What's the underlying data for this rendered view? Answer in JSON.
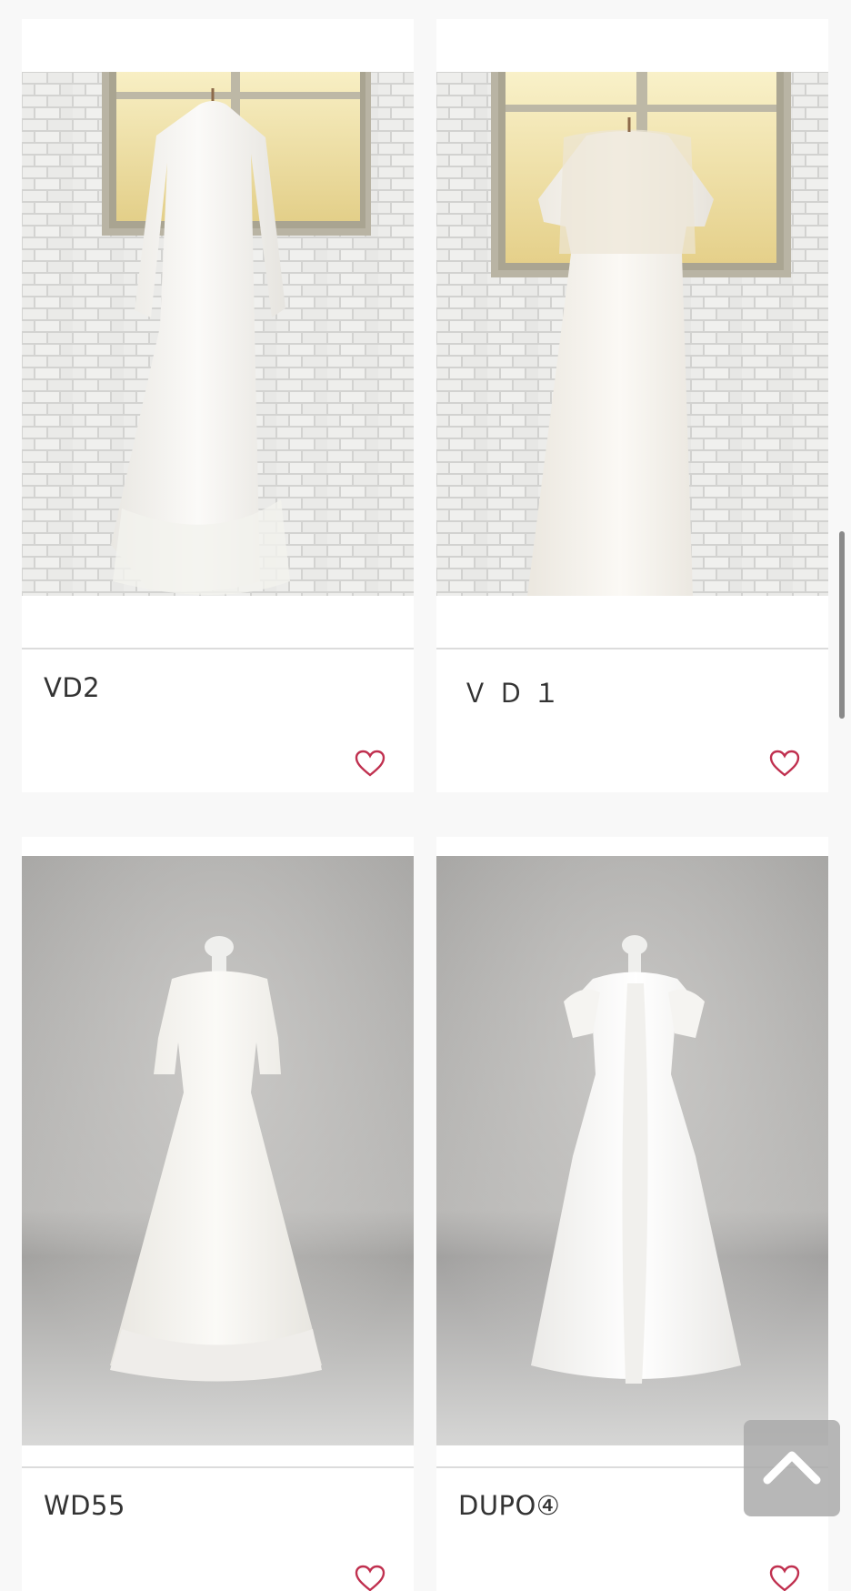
{
  "products": [
    {
      "title": "VD2",
      "image": "wedding-dress-hanging-window-lace-long-sleeve",
      "favorite_icon": "heart-outline-icon"
    },
    {
      "title": "Ｖ Ｄ １",
      "image": "wedding-dress-hanging-window-lace-short-sleeve",
      "favorite_icon": "heart-outline-icon"
    },
    {
      "title": "WD55",
      "image": "wedding-dress-mannequin-lace-half-sleeve",
      "favorite_icon": "heart-outline-icon"
    },
    {
      "title": "DUPO④",
      "image": "wedding-dress-mannequin-ruffle-flutter-sleeve",
      "favorite_icon": "heart-outline-icon"
    }
  ],
  "back_to_top_icon": "chevron-up-icon",
  "colors": {
    "heart": "#c0304f",
    "background": "#f8f8f8",
    "card": "#ffffff"
  }
}
